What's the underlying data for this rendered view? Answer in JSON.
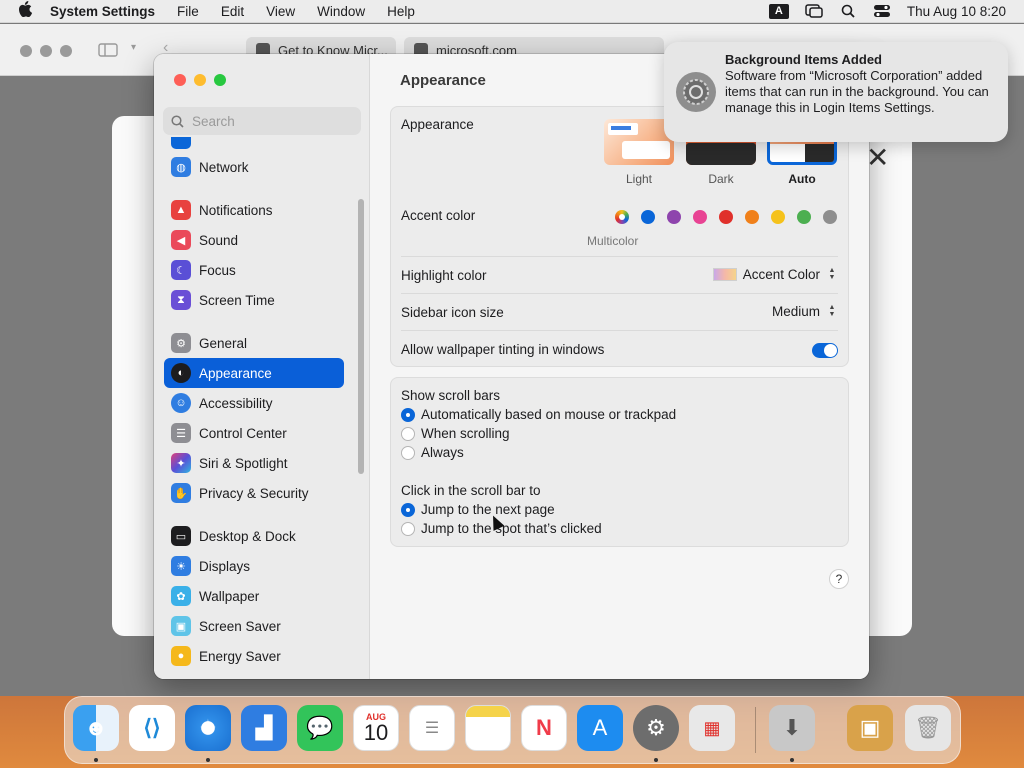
{
  "menubar": {
    "app_name": "System Settings",
    "menus": [
      "File",
      "Edit",
      "View",
      "Window",
      "Help"
    ],
    "input_source": "A",
    "datetime": "Thu Aug 10  8:20"
  },
  "browser": {
    "tab1": "Get to Know Micr...",
    "tab2": "microsoft.com"
  },
  "settings": {
    "search_placeholder": "Search",
    "sidebar": {
      "network": "Network",
      "notifications": "Notifications",
      "sound": "Sound",
      "focus": "Focus",
      "screen_time": "Screen Time",
      "general": "General",
      "appearance": "Appearance",
      "accessibility": "Accessibility",
      "control_center": "Control Center",
      "siri": "Siri & Spotlight",
      "privacy": "Privacy & Security",
      "desktop": "Desktop & Dock",
      "displays": "Displays",
      "wallpaper": "Wallpaper",
      "screen_saver": "Screen Saver",
      "energy": "Energy Saver"
    },
    "title": "Appearance",
    "appearance_label": "Appearance",
    "modes": {
      "light": "Light",
      "dark": "Dark",
      "auto": "Auto"
    },
    "selected_mode": "Auto",
    "accent_label": "Accent color",
    "accent_caption": "Multicolor",
    "accent_colors": [
      "#7a5ae0",
      "#0a66d8",
      "#8e44ad",
      "#e84393",
      "#e0302b",
      "#f0801a",
      "#f5c21b",
      "#4caf50",
      "#8e8e8e"
    ],
    "highlight_label": "Highlight color",
    "highlight_value": "Accent Color",
    "icon_size_label": "Sidebar icon size",
    "icon_size_value": "Medium",
    "tinting_label": "Allow wallpaper tinting in windows",
    "tinting_on": true,
    "scrollbars_label": "Show scroll bars",
    "scrollbar_options": [
      "Automatically based on mouse or trackpad",
      "When scrolling",
      "Always"
    ],
    "click_label": "Click in the scroll bar to",
    "click_options": [
      "Jump to the next page",
      "Jump to the spot that’s clicked"
    ],
    "help": "?"
  },
  "notification": {
    "title": "Background Items Added",
    "body": "Software from “Microsoft Corporation” added items that can run in the background. You can manage this in Login Items Settings."
  },
  "dock": {
    "calendar_month": "AUG",
    "calendar_day": "10"
  }
}
